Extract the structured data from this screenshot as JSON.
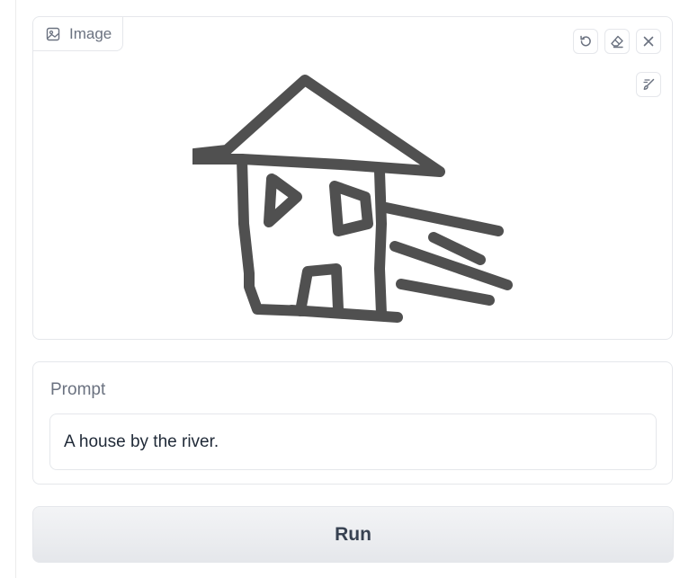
{
  "image_panel": {
    "label": "Image",
    "label_icon": "image-icon",
    "tools": [
      "undo-icon",
      "eraser-icon",
      "close-icon",
      "brush-icon"
    ],
    "stroke_color": "#505050"
  },
  "prompt": {
    "label": "Prompt",
    "value": "A house by the river."
  },
  "run_button": {
    "label": "Run"
  }
}
